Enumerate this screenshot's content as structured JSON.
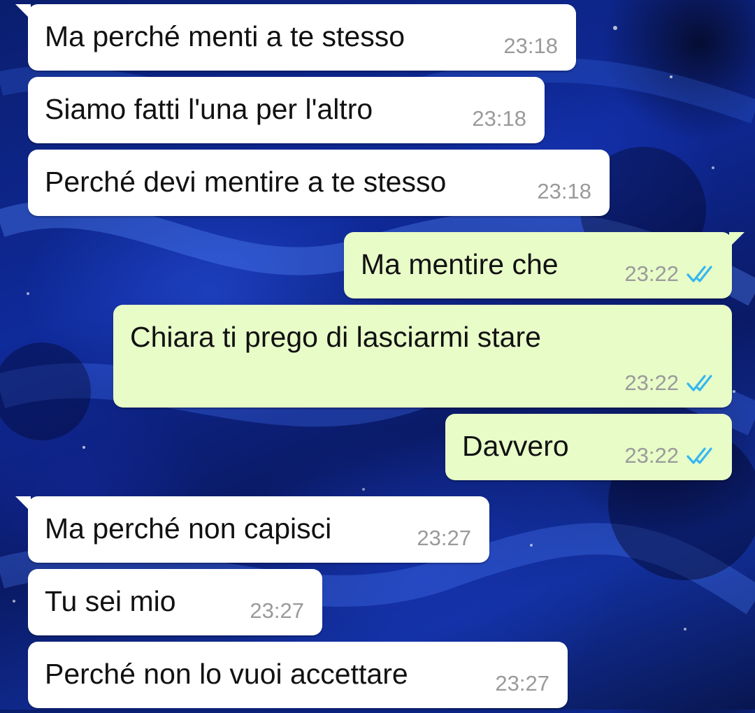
{
  "chat": {
    "messages": [
      {
        "text": "Ma perché menti a te stesso",
        "time": "23:18",
        "direction": "incoming"
      },
      {
        "text": "Siamo fatti l'una per l'altro",
        "time": "23:18",
        "direction": "incoming"
      },
      {
        "text": "Perché devi mentire a te stesso",
        "time": "23:18",
        "direction": "incoming"
      },
      {
        "text": "Ma mentire che",
        "time": "23:22",
        "direction": "outgoing",
        "status": "read-double-check"
      },
      {
        "text": "Chiara ti prego di lasciarmi stare",
        "time": "23:22",
        "direction": "outgoing",
        "status": "read-double-check"
      },
      {
        "text": "Davvero",
        "time": "23:22",
        "direction": "outgoing",
        "status": "read-double-check"
      },
      {
        "text": "Ma perché non capisci",
        "time": "23:27",
        "direction": "incoming"
      },
      {
        "text": "Tu sei mio",
        "time": "23:27",
        "direction": "incoming"
      },
      {
        "text": "Perché non lo vuoi accettare",
        "time": "23:27",
        "direction": "incoming"
      }
    ]
  },
  "colors": {
    "incoming_bubble": "#ffffff",
    "outgoing_bubble": "#e8fcc8",
    "read_ticks": "#34b7f1",
    "timestamp": "#9a9a9a",
    "wallpaper": "#0f2a9a"
  }
}
